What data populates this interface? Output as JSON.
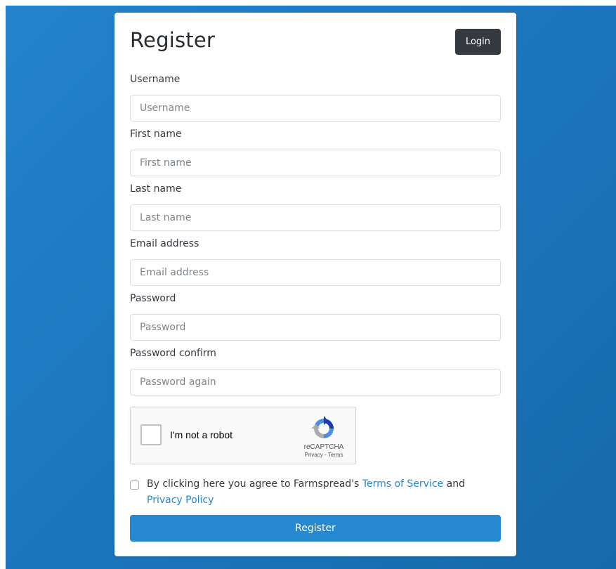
{
  "form": {
    "title": "Register",
    "login_label": "Login",
    "fields": [
      {
        "label": "Username",
        "placeholder": "Username",
        "value": ""
      },
      {
        "label": "First name",
        "placeholder": "First name",
        "value": ""
      },
      {
        "label": "Last name",
        "placeholder": "Last name",
        "value": ""
      },
      {
        "label": "Email address",
        "placeholder": "Email address",
        "value": ""
      },
      {
        "label": "Password",
        "placeholder": "Password",
        "value": ""
      },
      {
        "label": "Password confirm",
        "placeholder": "Password again",
        "value": ""
      }
    ],
    "agree": {
      "prefix": "By clicking here you agree to Farmspread's ",
      "terms": "Terms of Service",
      "middle": " and ",
      "privacy": "Privacy Policy"
    },
    "register_label": "Register"
  },
  "captcha": {
    "text": "I'm not a robot",
    "brand": "reCAPTCHA",
    "privacy": "Privacy",
    "separator": " - ",
    "terms": "Terms",
    "icon": "recaptcha-logo-icon"
  },
  "colors": {
    "background": "#1c74bb",
    "primary": "#2688d1",
    "dark_button": "#343a40",
    "link": "#2a86c9"
  }
}
